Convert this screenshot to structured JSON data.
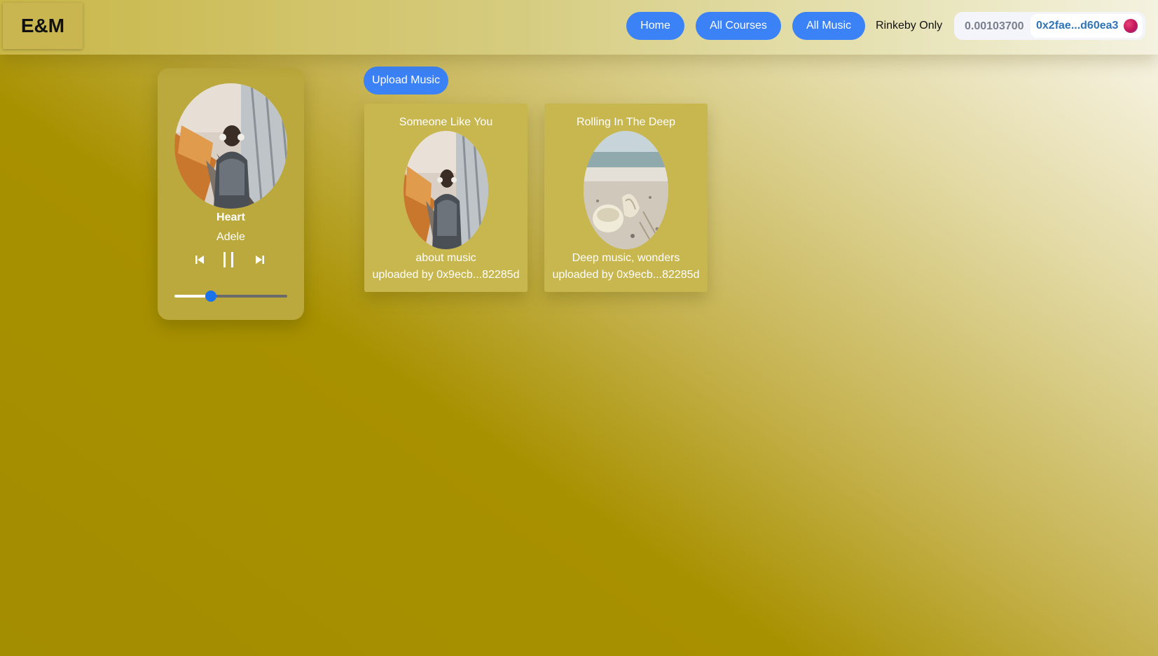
{
  "header": {
    "logo": "E&M",
    "nav": [
      {
        "label": "Home"
      },
      {
        "label": "All Courses"
      },
      {
        "label": "All Music"
      }
    ],
    "network_note": "Rinkeby Only",
    "wallet": {
      "balance": "0.00103700",
      "address": "0x2fae...d60ea3"
    }
  },
  "player": {
    "title": "Heart",
    "artist": "Adele",
    "progress_fraction": 0.32,
    "controls": {
      "previous_icon": "skip-previous-icon",
      "pause_icon": "pause-icon",
      "next_icon": "skip-next-icon"
    }
  },
  "upload_label": "Upload Music",
  "tracks": [
    {
      "title": "Someone Like You",
      "description": "about music",
      "uploader": "uploaded by 0x9ecb...82285d",
      "art_icon": "city-bridge-listener-image"
    },
    {
      "title": "Rolling In The Deep",
      "description": "Deep music, wonders",
      "uploader": "uploaded by 0x9ecb...82285d",
      "art_icon": "beach-shells-image"
    }
  ],
  "colors": {
    "accent": "#3b82f6",
    "slider_thumb": "#1a73e8",
    "address_text": "#2f74b8"
  }
}
